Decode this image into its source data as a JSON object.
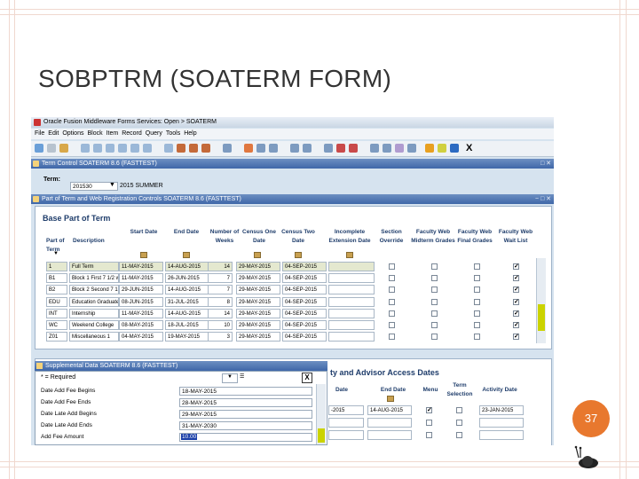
{
  "slide": {
    "title": "SOBPTRM (SOATERM FORM)",
    "page_number": "37"
  },
  "window": {
    "title": "Oracle Fusion Middleware Forms Services: Open > SOATERM",
    "menu": [
      "File",
      "Edit",
      "Options",
      "Block",
      "Item",
      "Record",
      "Query",
      "Tools",
      "Help"
    ]
  },
  "term_control": {
    "header": "Term Control SOATERM 8.6 (FASTTEST)",
    "term_label": "Term:",
    "term_code": "201530",
    "term_desc": "2015 SUMMER"
  },
  "part_of_term": {
    "header": "Part of Term and Web Registration Controls SOATERM 8.6 (FASTTEST)",
    "section_title": "Base Part of Term",
    "columns": [
      "Part of Term",
      "Description",
      "Start Date",
      "End Date",
      "Number of Weeks",
      "Census One Date",
      "Census Two Date",
      "Incomplete Extension Date",
      "Section Override",
      "Faculty Web Midterm Grades",
      "Faculty Web Final Grades",
      "Faculty Web Wait List"
    ],
    "rows": [
      {
        "code": "1",
        "desc": "Full Term",
        "start": "11-MAY-2015",
        "end": "14-AUG-2015",
        "weeks": "14",
        "c1": "29-MAY-2015",
        "c2": "04-SEP-2015",
        "override": false,
        "mid": false,
        "final": false,
        "wait": true
      },
      {
        "code": "B1",
        "desc": "Block 1 First 7 1/2 w",
        "start": "11-MAY-2015",
        "end": "26-JUN-2015",
        "weeks": "7",
        "c1": "29-MAY-2015",
        "c2": "04-SEP-2015",
        "override": false,
        "mid": false,
        "final": false,
        "wait": true
      },
      {
        "code": "B2",
        "desc": "Block 2 Second 7 1",
        "start": "29-JUN-2015",
        "end": "14-AUG-2015",
        "weeks": "7",
        "c1": "29-MAY-2015",
        "c2": "04-SEP-2015",
        "override": false,
        "mid": false,
        "final": false,
        "wait": true
      },
      {
        "code": "EDU",
        "desc": "Education Graduate",
        "start": "08-JUN-2015",
        "end": "31-JUL-2015",
        "weeks": "8",
        "c1": "29-MAY-2015",
        "c2": "04-SEP-2015",
        "override": false,
        "mid": false,
        "final": false,
        "wait": true
      },
      {
        "code": "INT",
        "desc": "Internship",
        "start": "11-MAY-2015",
        "end": "14-AUG-2015",
        "weeks": "14",
        "c1": "29-MAY-2015",
        "c2": "04-SEP-2015",
        "override": false,
        "mid": false,
        "final": false,
        "wait": true
      },
      {
        "code": "WC",
        "desc": "Weekend College",
        "start": "08-MAY-2015",
        "end": "18-JUL-2015",
        "weeks": "10",
        "c1": "29-MAY-2015",
        "c2": "04-SEP-2015",
        "override": false,
        "mid": false,
        "final": false,
        "wait": true
      },
      {
        "code": "Z01",
        "desc": "Miscellaneous 1",
        "start": "04-MAY-2015",
        "end": "19-MAY-2015",
        "weeks": "3",
        "c1": "29-MAY-2015",
        "c2": "04-SEP-2015",
        "override": false,
        "mid": false,
        "final": false,
        "wait": true
      }
    ]
  },
  "advisor_access": {
    "section_title": "ty and Advisor Access Dates",
    "columns": [
      "Date",
      "End Date",
      "Menu",
      "Term Selection",
      "Activity Date"
    ],
    "row": {
      "start": "-2015",
      "end": "14-AUG-2015",
      "menu": true,
      "term_sel": false,
      "activity": "23-JAN-2015"
    }
  },
  "supplemental": {
    "header": "Supplemental Data SOATERM 8.6 (FASTTEST)",
    "required_note": "* = Required",
    "items": [
      {
        "label": "Date Add Fee Begins",
        "value": "18-MAY-2015"
      },
      {
        "label": "Date Add Fee Ends",
        "value": "28-MAY-2015"
      },
      {
        "label": "Date Late Add Begins",
        "value": "29-MAY-2015"
      },
      {
        "label": "Date Late Add Ends",
        "value": "31-MAY-2030"
      },
      {
        "label": "Add Fee Amount",
        "value": "10.00"
      }
    ]
  }
}
